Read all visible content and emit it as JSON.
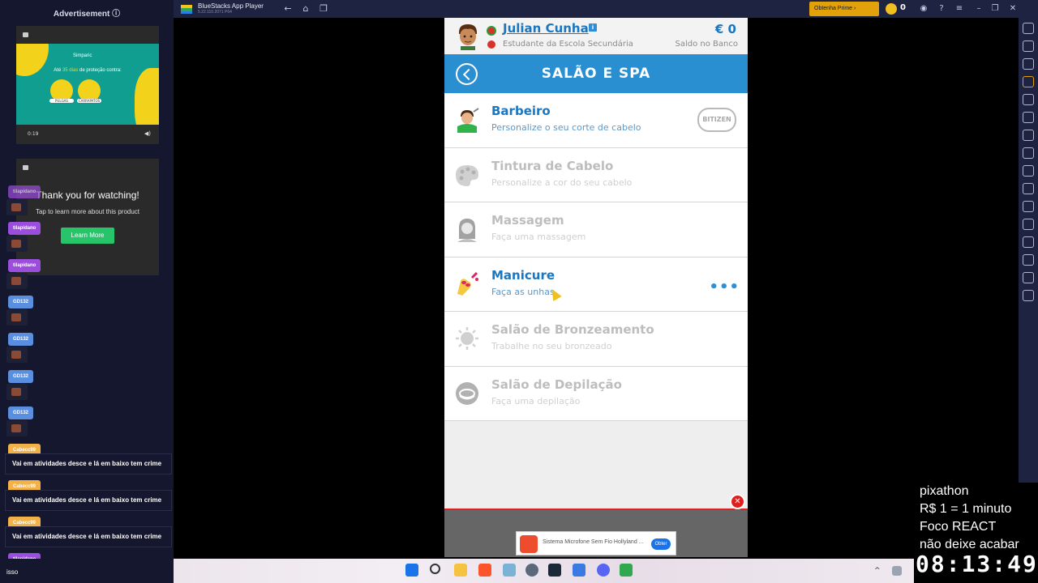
{
  "left_panel": {
    "ad_title": "Advertisement ⓘ",
    "ad1": {
      "brand": "Simparic",
      "line_prefix": "Até ",
      "line_highlight": "35 dias",
      "line_suffix": " de proteção contra:",
      "badge1": "PULGAS",
      "badge2": "CARRAPATOS",
      "time": "0:19"
    },
    "ad2": {
      "thanks": "Thank you for watching!",
      "tap": "Tap to learn more about this product",
      "learn_more": "Learn More"
    },
    "chat": [
      {
        "user": "tilapidano",
        "color": "purple"
      },
      {
        "user": "tilapidano",
        "color": "purple"
      },
      {
        "user": "tilapidano",
        "color": "purple"
      },
      {
        "user": "GD132",
        "color": "blue"
      },
      {
        "user": "GD132",
        "color": "blue"
      },
      {
        "user": "GD132",
        "color": "blue"
      },
      {
        "user": "GD132",
        "color": "blue"
      },
      {
        "user": "Cabecc99",
        "color": "orange",
        "message": "Vai em atividades desce e lá em baixo tem crime"
      },
      {
        "user": "Cabecc99",
        "color": "orange",
        "message": "Vai em atividades desce e lá em baixo tem crime"
      },
      {
        "user": "Cabecc99",
        "color": "orange",
        "message": "Vai em atividades desce e lá em baixo tem crime"
      },
      {
        "user": "tilapidano",
        "color": "purple",
        "message": "isso"
      }
    ]
  },
  "bluestacks": {
    "title": "BlueStacks App Player",
    "version": "5.22.110.2071 P64",
    "prime_label": "Obtenha Prime ›",
    "coins": "0"
  },
  "game": {
    "player_name": "Julian Cunha",
    "player_status": "Estudante da Escola Secundária",
    "money": "€ 0",
    "money_label": "Saldo no Banco",
    "screen_title": "SALÃO E SPA",
    "items": [
      {
        "title": "Barbeiro",
        "subtitle": "Personalize o seu corte de cabelo",
        "state": "active",
        "badge": "BITIZEN"
      },
      {
        "title": "Tintura de Cabelo",
        "subtitle": "Personalize a cor do seu cabelo",
        "state": "disabled"
      },
      {
        "title": "Massagem",
        "subtitle": "Faça uma massagem",
        "state": "disabled"
      },
      {
        "title": "Manicure",
        "subtitle": "Faça as unhas",
        "state": "active",
        "more": "•••"
      },
      {
        "title": "Salão de Bronzeamento",
        "subtitle": "Trabalhe no seu bronzeado",
        "state": "disabled"
      },
      {
        "title": "Salão de Depilação",
        "subtitle": "Faça uma depilação",
        "state": "disabled"
      }
    ],
    "ad_banner": {
      "text": "Sistema Microfone Sem Fio Hollyland ...",
      "cta": "Obter"
    }
  },
  "overlay": {
    "lines": [
      "pixathon",
      "R$ 1 = 1 minuto",
      "Foco REACT",
      "não deixe acabar"
    ],
    "clock": "08:13:49"
  }
}
